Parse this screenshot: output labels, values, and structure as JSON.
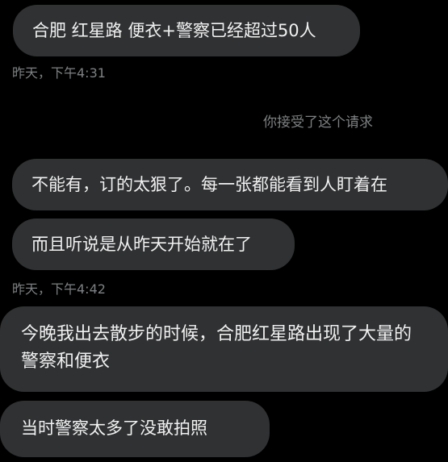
{
  "messages": [
    {
      "text": "合肥 红星路 便衣+警察已经超过50人"
    },
    {
      "text": "不能有，订的太狠了。每一张都能看到人盯着在"
    },
    {
      "text": "而且听说是从昨天开始就在了"
    },
    {
      "text": "今晚我出去散步的时候，合肥红星路出现了大量的警察和便衣"
    },
    {
      "text": "当时警察太多了没敢拍照"
    }
  ],
  "timestamps": [
    "昨天，下午4:31",
    "昨天，下午4:42"
  ],
  "system_note": "你接受了这个请求",
  "colors": {
    "background": "#000000",
    "bubble": "#2f3133",
    "bubble_text": "#f1f1f1",
    "meta_text": "#7d8082"
  }
}
